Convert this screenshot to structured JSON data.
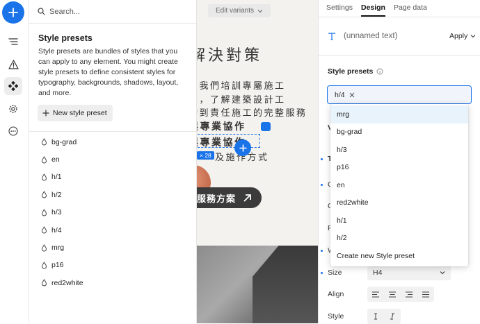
{
  "left_rail": {
    "icons": [
      "plus-icon",
      "navigator-icon",
      "warning-icon",
      "components-icon",
      "settings-icon",
      "more-icon"
    ]
  },
  "presets_panel": {
    "search_placeholder": "Search...",
    "title": "Style presets",
    "description": "Style presets are bundles of styles that you can apply to any element. You might create style presets to define consistent styles for typography, backgrounds, shadows, layout, and more.",
    "new_button_label": "New style preset",
    "items": [
      "bg-grad",
      "en",
      "h/1",
      "h/2",
      "h/3",
      "h/4",
      "mrg",
      "p16",
      "red2white"
    ]
  },
  "canvas": {
    "variant_chip": "Edit variants",
    "heading": "解決對策",
    "lines": [
      "，我們培訓專屬施工",
      "品，了解建築設計工",
      "詢到責任施工的完整服務"
    ],
    "bold_line_1": "與專業協作",
    "bold_line_2": "與專業協作",
    "tail_line": "及施作方式",
    "badge": "28",
    "cta_label": "服務方案"
  },
  "settings_panel": {
    "tabs": [
      "Settings",
      "Design",
      "Page data"
    ],
    "active_tab": "Design",
    "element_name": "(unnamed text)",
    "apply_label": "Apply",
    "style_presets_label": "Style presets",
    "selected_tag": "h/4",
    "rows": {
      "size_label": "Size",
      "size_value": "H4",
      "align_label": "Align",
      "style_label": "Style"
    },
    "partial_labels": [
      "V",
      "T",
      "C",
      "C",
      "F",
      "W"
    ]
  },
  "dropdown": {
    "options": [
      "mrg",
      "bg-grad",
      "h/3",
      "p16",
      "en",
      "red2white",
      "h/1",
      "h/2",
      "Create new Style preset"
    ],
    "highlighted": "mrg"
  },
  "colors": {
    "accent": "#1a73e8",
    "highlight": "#e8f3fb"
  }
}
